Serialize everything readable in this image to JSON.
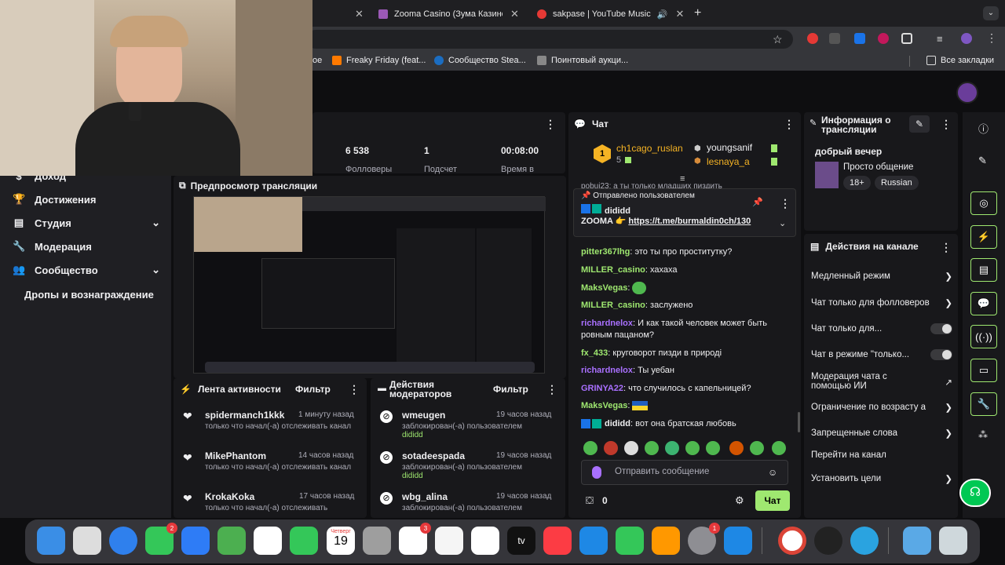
{
  "browser": {
    "tabs": [
      {
        "label": "Zooma Casino (Зума Казино",
        "favicon": "#9b59b6"
      },
      {
        "label": "sakpase | YouTube Music",
        "favicon": "#e53935"
      }
    ],
    "new_tab": "+",
    "bookmarks": [
      {
        "label": "Freaky Friday (feat...",
        "color": "#ff7a00"
      },
      {
        "label": "Сообщество Stea...",
        "color": "#1b6dc1"
      },
      {
        "label": "Поинтовый аукци...",
        "color": "#888"
      }
    ],
    "bookmarks_partial": "oe",
    "all_bookmarks": "Все закладки"
  },
  "sidebar": {
    "items": [
      {
        "label": "Доход",
        "icon": "income-icon"
      },
      {
        "label": "Достижения",
        "icon": "trophy-icon"
      },
      {
        "label": "Студия",
        "icon": "studio-icon",
        "expandable": true
      },
      {
        "label": "Модерация",
        "icon": "wrench-icon"
      },
      {
        "label": "Сообщество",
        "icon": "people-icon",
        "expandable": true
      }
    ],
    "drops": "Дропы и вознаграждение"
  },
  "stats": {
    "followers_value": "6 538",
    "followers_label": "Фолловеры",
    "subs_value": "1",
    "subs_label": "Подсчет",
    "time_value": "00:08:00",
    "time_label": "Время в"
  },
  "preview": {
    "title": "Предпросмотр трансляции"
  },
  "activity": {
    "title": "Лента активности",
    "filter": "Фильтр",
    "items": [
      {
        "name": "spidermanch1kkk",
        "time": "1 минуту назад",
        "text": "только что начал(-а) отслеживать канал"
      },
      {
        "name": "MikePhantom",
        "time": "14 часов назад",
        "text": "только что начал(-а) отслеживать канал"
      },
      {
        "name": "KrokaKoka",
        "time": "17 часов назад",
        "text": "только что начал(-а) отслеживать"
      }
    ]
  },
  "modactions": {
    "title": "Действия модераторов",
    "filter": "Фильтр",
    "items": [
      {
        "name": "wmeugen",
        "time": "19 часов назад",
        "text": "заблокирован(-а) пользователем",
        "by": "dididd"
      },
      {
        "name": "sotadeespada",
        "time": "19 часов назад",
        "text": "заблокирован(-а) пользователем",
        "by": "dididd"
      },
      {
        "name": "wbg_alina",
        "time": "19 часов назад",
        "text": "заблокирован(-а) пользователем",
        "by": ""
      }
    ]
  },
  "chat": {
    "title": "Чат",
    "leader": {
      "rank": "1",
      "name": "ch1cago_ruslan",
      "count": "5"
    },
    "leaders_side": [
      {
        "name": "youngsanif"
      },
      {
        "name": "lesnaya_a"
      }
    ],
    "partial_message": "pobuj23: а ты только младших пиздить",
    "pinned": {
      "label": "Отправлено пользователем",
      "user": "dididd",
      "text": "ZOOMA 👉",
      "link": "https://t.me/burmaldin0ch/130"
    },
    "messages": [
      {
        "user": "pitter367lhg",
        "text": "это ты про проститутку?",
        "color": "#9fe870"
      },
      {
        "user": "MILLER_casino",
        "text": "хахаха",
        "color": "#9fe870"
      },
      {
        "user": "MaksVegas",
        "text": "",
        "color": "#9fe870"
      },
      {
        "user": "MILLER_casino",
        "text": "заслужено",
        "color": "#9fe870"
      },
      {
        "user": "richardnelox",
        "text": "И как такой человек может быть ровным пацаном?",
        "color": "#a970ff"
      },
      {
        "user": "fx_433",
        "text": "круговорот пизди в природі",
        "color": "#9fe870"
      },
      {
        "user": "richardnelox",
        "text": "Ты уебан",
        "color": "#a970ff"
      },
      {
        "user": "GRINYA22",
        "text": "что случилось с капельницей?",
        "color": "#a970ff"
      },
      {
        "user": "MaksVegas",
        "text": "",
        "color": "#9fe870"
      },
      {
        "user": "dididd",
        "text": "вот она братская любовь",
        "color": "#ffffff"
      }
    ],
    "placeholder": "Отправить сообщение",
    "points": "0",
    "send": "Чат"
  },
  "info": {
    "title": "Информация о трансляции",
    "stream_title": "добрый вечер",
    "category": "Просто общение",
    "tags": [
      "18+",
      "Russian"
    ]
  },
  "channel_actions": {
    "title": "Действия на канале",
    "items": [
      {
        "label": "Медленный режим",
        "kind": "arrow"
      },
      {
        "label": "Чат только для фолловеров",
        "kind": "arrow"
      },
      {
        "label": "Чат только для...",
        "kind": "toggle"
      },
      {
        "label": "Чат в режиме \"только...",
        "kind": "toggle"
      },
      {
        "label": "Модерация чата с помощью ИИ",
        "kind": "external"
      },
      {
        "label": "Ограничение по возрасту а",
        "kind": "arrow"
      },
      {
        "label": "Запрещенные слова",
        "kind": "arrow"
      },
      {
        "label": "Перейти на канал",
        "kind": "none"
      },
      {
        "label": "Установить цели",
        "kind": "arrow"
      }
    ]
  },
  "dock": {
    "calendar_month": "Четверг",
    "calendar_day": "19",
    "badges": {
      "messages": "2",
      "reminders": "3",
      "settings": "1"
    },
    "tv_label": "tv"
  }
}
